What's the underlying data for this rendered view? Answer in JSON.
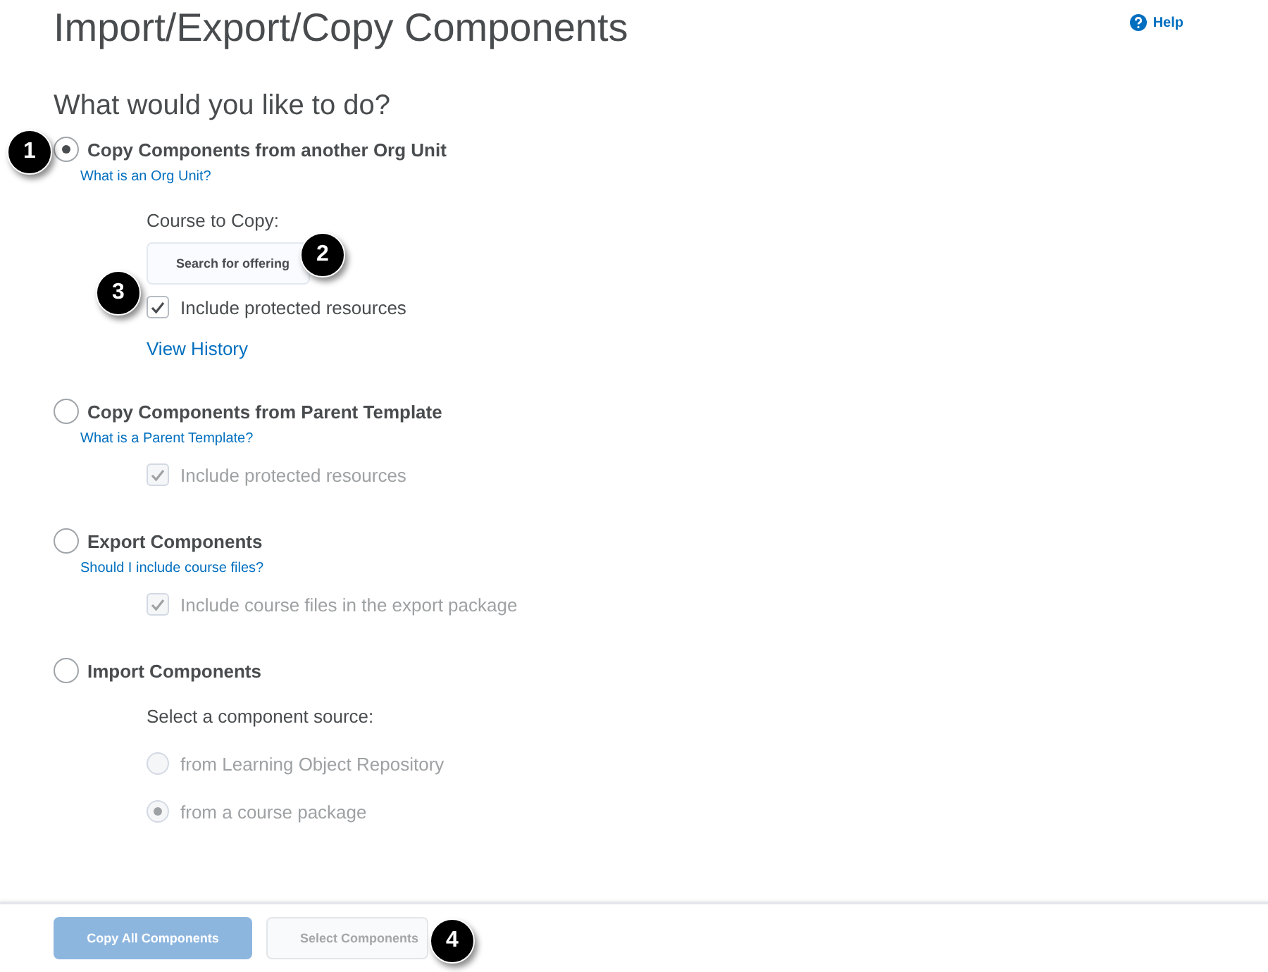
{
  "title": "Import/Export/Copy Components",
  "help": "Help",
  "heading": "What would you like to do?",
  "options": [
    {
      "label": "Copy Components from another Org Unit",
      "selected": true,
      "link": "What is an Org Unit?",
      "items": [
        {
          "kind": "label",
          "text": "Course to Copy:"
        },
        {
          "kind": "search",
          "placeholder": "Search for offering"
        },
        {
          "kind": "checkbox",
          "text": "Include protected resources",
          "checked": true,
          "disabled": false
        },
        {
          "kind": "link",
          "text": "View History"
        }
      ]
    },
    {
      "label": "Copy Components from Parent Template",
      "selected": false,
      "link": "What is a Parent Template?",
      "items": [
        {
          "kind": "checkbox",
          "text": "Include protected resources",
          "checked": true,
          "disabled": true
        }
      ]
    },
    {
      "label": "Export Components",
      "selected": false,
      "link": "Should I include course files?",
      "items": [
        {
          "kind": "checkbox",
          "text": "Include course files in the export package",
          "checked": true,
          "disabled": true
        }
      ]
    },
    {
      "label": "Import Components",
      "selected": false,
      "items": [
        {
          "kind": "label",
          "text": "Select a component source:"
        },
        {
          "kind": "radio",
          "text": "from Learning Object Repository",
          "selected": false,
          "disabled": true
        },
        {
          "kind": "radio",
          "text": "from a course package",
          "selected": true,
          "disabled": true
        }
      ]
    }
  ],
  "buttons": [
    {
      "label": "Copy All Components",
      "kind": "primary",
      "disabled": true
    },
    {
      "label": "Select Components",
      "kind": "secondary",
      "disabled": true
    }
  ],
  "callouts": [
    "1",
    "2",
    "3",
    "4"
  ]
}
